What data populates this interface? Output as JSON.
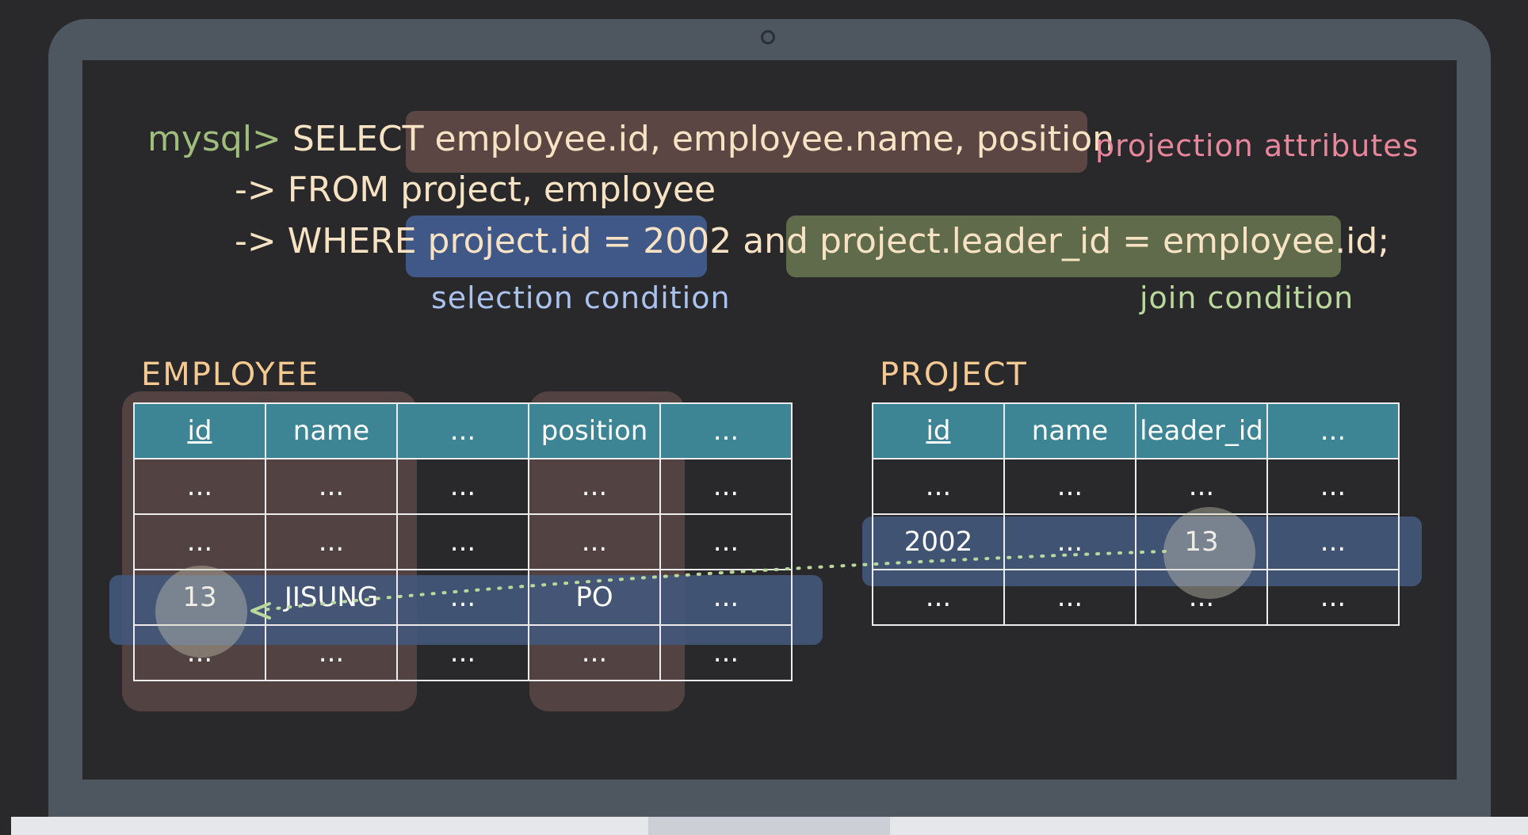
{
  "query": {
    "prompt": "mysql>",
    "select_keyword": "SELECT",
    "select_attrs": "employee.id, employee.name, position",
    "continuation": "->",
    "from_clause": "FROM project, employee",
    "where_keyword": "WHERE",
    "selection_expr": "project.id = 2002",
    "and_keyword": "and",
    "join_expr": "project.leader_id = employee.id",
    "terminator": ";"
  },
  "annotations": {
    "projection": "projection attributes",
    "selection": "selection condition",
    "join": "join condition"
  },
  "employee_table": {
    "title": "EMPLOYEE",
    "headers": [
      "id",
      "name",
      "...",
      "position",
      "..."
    ],
    "rows": [
      [
        "...",
        "...",
        "...",
        "...",
        "..."
      ],
      [
        "...",
        "...",
        "...",
        "...",
        "..."
      ],
      [
        "13",
        "JISUNG",
        "...",
        "PO",
        "..."
      ],
      [
        "...",
        "...",
        "...",
        "...",
        "..."
      ]
    ]
  },
  "project_table": {
    "title": "PROJECT",
    "headers": [
      "id",
      "name",
      "leader_id",
      "..."
    ],
    "rows": [
      [
        "...",
        "...",
        "...",
        "..."
      ],
      [
        "2002",
        "...",
        "13",
        "..."
      ],
      [
        "...",
        "...",
        "...",
        "..."
      ]
    ]
  },
  "colors": {
    "projection_highlight": "#5c4644",
    "selection_highlight": "#3f5888",
    "join_highlight": "#5f6b4a",
    "projection_label": "#e8869b",
    "selection_label": "#a9c2ee",
    "join_label": "#b8d99b",
    "header_fill": "#3d8494",
    "prompt": "#9fbe7c",
    "keyword": "#f7e3c4"
  }
}
